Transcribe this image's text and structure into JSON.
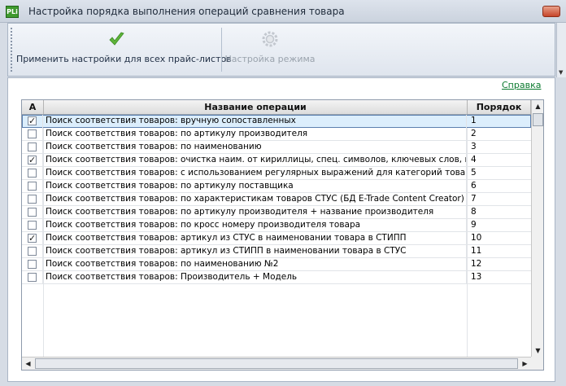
{
  "window": {
    "app_icon_text": "PLi",
    "title": "Настройка порядка выполнения операций сравнения товара"
  },
  "toolbar": {
    "apply_all_label": "Применить настройки для всех прайс-листов",
    "mode_settings_label": "Настройка режима"
  },
  "help_link": "Справка",
  "grid": {
    "columns": [
      "A",
      "Название операции",
      "Порядок"
    ],
    "rows": [
      {
        "checked": true,
        "check_mark": "✓",
        "name": "Поиск соответствия товаров: вручную сопоставленных",
        "order": "1"
      },
      {
        "checked": false,
        "check_mark": "",
        "name": "Поиск соответствия товаров: по артикулу производителя",
        "order": "2"
      },
      {
        "checked": false,
        "check_mark": "",
        "name": "Поиск соответствия товаров: по наименованию",
        "order": "3"
      },
      {
        "checked": true,
        "check_mark": "✓",
        "name": "Поиск соответствия товаров: очистка наим. от кириллицы, спец. символов, ключевых слов, поиск о",
        "order": "4"
      },
      {
        "checked": false,
        "check_mark": "",
        "name": "Поиск соответствия товаров: с использованием регулярных выражений для категорий товара",
        "order": "5"
      },
      {
        "checked": false,
        "check_mark": "",
        "name": "Поиск соответствия товаров: по артикулу поставщика",
        "order": "6"
      },
      {
        "checked": false,
        "check_mark": "",
        "name": "Поиск соответствия товаров: по характеристикам товаров СТУС (БД E-Trade Content Creator)",
        "order": "7"
      },
      {
        "checked": false,
        "check_mark": "",
        "name": "Поиск соответствия товаров: по артикулу производителя + название производителя",
        "order": "8"
      },
      {
        "checked": false,
        "check_mark": "",
        "name": "Поиск соответствия товаров: по кросс номеру производителя товара",
        "order": "9"
      },
      {
        "checked": true,
        "check_mark": "✓",
        "name": "Поиск соответствия товаров: артикул из СТУС в наименовании товара в СТИПП",
        "order": "10"
      },
      {
        "checked": false,
        "check_mark": "",
        "name": "Поиск соответствия товаров: артикул из СТИПП в наименовании товара в СТУС",
        "order": "11"
      },
      {
        "checked": false,
        "check_mark": "",
        "name": "Поиск соответствия товаров: по наименованию №2",
        "order": "12"
      },
      {
        "checked": false,
        "check_mark": "",
        "name": "Поиск соответствия товаров: Производитель + Модель",
        "order": "13"
      }
    ]
  },
  "icons": {
    "apply": "green-checkmark-icon",
    "mode": "gear-icon"
  },
  "colors": {
    "link": "#0a7a2e",
    "selected_row": "#dceefc",
    "check_green": "#5fb43a"
  }
}
